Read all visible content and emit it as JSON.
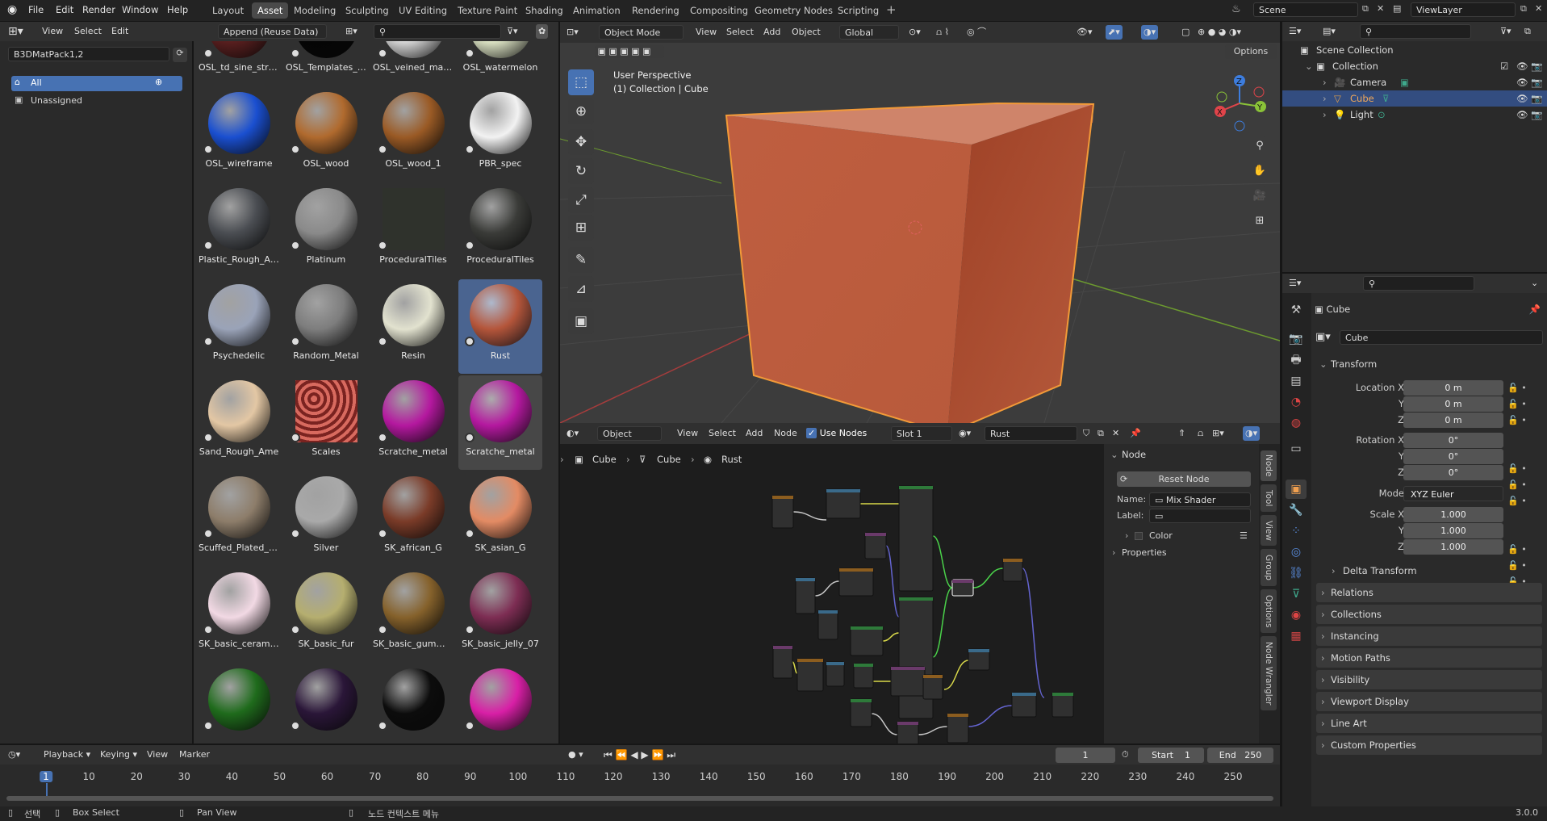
{
  "menu": {
    "file": "File",
    "edit": "Edit",
    "render": "Render",
    "window": "Window",
    "help": "Help"
  },
  "workspaces": [
    "Layout",
    "Asset",
    "Modeling",
    "Sculpting",
    "UV Editing",
    "Texture Paint",
    "Shading",
    "Animation",
    "Rendering",
    "Compositing",
    "Geometry Nodes",
    "Scripting"
  ],
  "top_right": {
    "scene": "Scene",
    "view_layer": "ViewLayer"
  },
  "asset_browser": {
    "menu": [
      "View",
      "Select",
      "Edit"
    ],
    "import_mode": "Append (Reuse Data)",
    "library": "B3DMatPack1,2",
    "catalogs": [
      "All",
      "Unassigned"
    ],
    "assets": [
      {
        "name": "OSL_td_sine_stripes",
        "color": "#5a1f1f"
      },
      {
        "name": "OSL_Templates_di...",
        "color": "#050505"
      },
      {
        "name": "OSL_veined_marble",
        "color": "#d9d9d9"
      },
      {
        "name": "OSL_watermelon",
        "color": "#dfe6c7"
      },
      {
        "name": "OSL_wireframe",
        "color": "#1a4fd0"
      },
      {
        "name": "OSL_wood",
        "color": "#b06a2e"
      },
      {
        "name": "OSL_wood_1",
        "color": "#9a5a25"
      },
      {
        "name": "PBR_spec",
        "color": "#f2f2f2"
      },
      {
        "name": "Plastic_Rough_Ame",
        "color": "#4a4d52"
      },
      {
        "name": "Platinum",
        "color": "#8a8a8a"
      },
      {
        "name": "ProceduralTiles",
        "color": "#2f322c"
      },
      {
        "name": "ProceduralTiles",
        "color": "#3a3b38"
      },
      {
        "name": "Psychedelic",
        "color": "#9aa3b8"
      },
      {
        "name": "Random_Metal",
        "color": "#7d7d7d"
      },
      {
        "name": "Resin",
        "color": "#e2e2cf"
      },
      {
        "name": "Rust",
        "color": "#b4553a"
      },
      {
        "name": "Sand_Rough_Ame",
        "color": "#e3c7a4"
      },
      {
        "name": "Scales",
        "color": "#a8433d"
      },
      {
        "name": "Scratche_metal",
        "color": "#b4189f"
      },
      {
        "name": "Scratche_metal",
        "color": "#b4189f"
      },
      {
        "name": "Scuffed_Plated_Me...",
        "color": "#8d7d6a"
      },
      {
        "name": "Silver",
        "color": "#a9a9a9"
      },
      {
        "name": "SK_african_G",
        "color": "#7a3b28"
      },
      {
        "name": "SK_asian_G",
        "color": "#e38b64"
      },
      {
        "name": "SK_basic_ceramic_...",
        "color": "#f2d9e4"
      },
      {
        "name": "SK_basic_fur",
        "color": "#b5ae6f"
      },
      {
        "name": "SK_basic_gummy_...",
        "color": "#85612b"
      },
      {
        "name": "SK_basic_jelly_07",
        "color": "#7d2d53"
      },
      {
        "name": "",
        "color": "#1f6b1c"
      },
      {
        "name": "",
        "color": "#2a1638"
      },
      {
        "name": "",
        "color": "#0c0c0c"
      },
      {
        "name": "",
        "color": "#d81fa6"
      }
    ]
  },
  "viewport": {
    "mode": "Object Mode",
    "menu": [
      "View",
      "Select",
      "Add",
      "Object"
    ],
    "orientation": "Global",
    "options": "Options",
    "info_line1": "User Perspective",
    "info_line2": "(1) Collection | Cube"
  },
  "node_editor": {
    "type": "Object",
    "menu": [
      "View",
      "Select",
      "Add",
      "Node"
    ],
    "use_nodes": "Use Nodes",
    "slot": "Slot 1",
    "material": "Rust",
    "breadcrumb": [
      "Cube",
      "Cube",
      "Rust"
    ],
    "panel": {
      "title": "Node",
      "reset": "Reset Node",
      "name_label": "Name:",
      "name_value": "Mix Shader",
      "label_label": "Label:",
      "label_value": "",
      "color": "Color",
      "properties": "Properties"
    },
    "side_tabs": [
      "Node",
      "Tool",
      "View",
      "Group",
      "Options",
      "Node Wrangler"
    ]
  },
  "outliner": {
    "root": "Scene Collection",
    "collection": "Collection",
    "items": [
      "Camera",
      "Cube",
      "Light"
    ]
  },
  "properties": {
    "object_name": "Cube",
    "data_name": "Cube",
    "transform": "Transform",
    "location_label": "Location X",
    "rotation_label": "Rotation X",
    "scale_label": "Scale X",
    "y": "Y",
    "z": "Z",
    "loc": [
      "0 m",
      "0 m",
      "0 m"
    ],
    "rot": [
      "0°",
      "0°",
      "0°"
    ],
    "mode_label": "Mode",
    "mode_value": "XYZ Euler",
    "scale": [
      "1.000",
      "1.000",
      "1.000"
    ],
    "sections": [
      "Delta Transform",
      "Relations",
      "Collections",
      "Instancing",
      "Motion Paths",
      "Visibility",
      "Viewport Display",
      "Line Art",
      "Custom Properties"
    ]
  },
  "timeline": {
    "menu": [
      "Playback",
      "Keying",
      "View",
      "Marker"
    ],
    "current_frame": "1",
    "start_label": "Start",
    "start": "1",
    "end_label": "End",
    "end": "250",
    "ticks": [
      "1",
      "10",
      "20",
      "30",
      "40",
      "50",
      "60",
      "70",
      "80",
      "90",
      "100",
      "110",
      "120",
      "130",
      "140",
      "150",
      "160",
      "170",
      "180",
      "190",
      "200",
      "210",
      "220",
      "230",
      "240",
      "250"
    ]
  },
  "statusbar": {
    "select": "선택",
    "box_select": "Box Select",
    "pan_view": "Pan View",
    "context_menu": "노드 컨텍스트 메뉴",
    "version": "3.0.0"
  }
}
